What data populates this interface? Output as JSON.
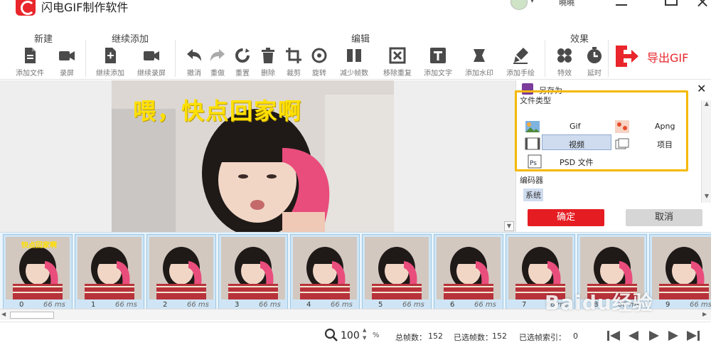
{
  "app": {
    "title": "闪电GIF制作软件",
    "user_name": "曉曉",
    "dropdown_glyph": "▾"
  },
  "toolbar": {
    "groups": [
      {
        "label": "新建"
      },
      {
        "label": "继续添加"
      },
      {
        "label": "编辑"
      },
      {
        "label": "效果"
      }
    ],
    "tools": [
      {
        "label": "添加文件",
        "icon": "document-icon"
      },
      {
        "label": "录屏",
        "icon": "video-camera-icon"
      },
      {
        "label": "继续添加",
        "icon": "document-add-icon"
      },
      {
        "label": "继续录屏",
        "icon": "video-camera-add-icon"
      },
      {
        "label": "撤消",
        "icon": "undo-icon"
      },
      {
        "label": "重做",
        "icon": "redo-icon"
      },
      {
        "label": "重置",
        "icon": "reset-icon"
      },
      {
        "label": "删除",
        "icon": "trash-icon"
      },
      {
        "label": "裁剪",
        "icon": "crop-icon"
      },
      {
        "label": "旋转",
        "icon": "rotate-icon"
      },
      {
        "label": "减少帧数",
        "icon": "reduce-frames-icon"
      },
      {
        "label": "移除重复",
        "icon": "remove-duplicate-icon"
      },
      {
        "label": "添加文字",
        "icon": "text-icon"
      },
      {
        "label": "添加水印",
        "icon": "watermark-icon"
      },
      {
        "label": "添加手绘",
        "icon": "brush-icon"
      },
      {
        "label": "特效",
        "icon": "effects-icon"
      },
      {
        "label": "延时",
        "icon": "timer-icon"
      }
    ],
    "export_label": "导出GIF"
  },
  "preview": {
    "caption": "喂，快点回家啊"
  },
  "save_panel": {
    "title": "另存为",
    "file_type_label": "文件类型",
    "options": [
      {
        "label": "Gif",
        "icon": "gif-image-icon"
      },
      {
        "label": "Apng",
        "icon": "apng-image-icon"
      },
      {
        "label": "视频",
        "icon": "video-film-icon",
        "selected": true
      },
      {
        "label": "项目",
        "icon": "project-icon"
      },
      {
        "label": "PSD 文件",
        "icon": "photoshop-icon"
      }
    ],
    "encoder_label": "编码器",
    "encoder_value": "系统",
    "confirm_label": "确定",
    "cancel_label": "取消"
  },
  "filmstrip": {
    "first_frame_caption": "快点回家啊",
    "frames": [
      {
        "index": "0",
        "duration": "66 ms"
      },
      {
        "index": "1",
        "duration": "66 ms"
      },
      {
        "index": "2",
        "duration": "66 ms"
      },
      {
        "index": "3",
        "duration": "66 ms"
      },
      {
        "index": "4",
        "duration": "66 ms"
      },
      {
        "index": "5",
        "duration": "66 ms"
      },
      {
        "index": "6",
        "duration": "66 ms"
      },
      {
        "index": "7",
        "duration": "66 ms"
      },
      {
        "index": "8",
        "duration": "66 ms"
      },
      {
        "index": "9",
        "duration": "66 ms"
      }
    ]
  },
  "status": {
    "zoom": "100",
    "zoom_unit": "%",
    "total_frames_label": "总帧数：",
    "total_frames": "152",
    "selected_frames_label": "已选帧数：",
    "selected_frames": "152",
    "selected_index_label": "已选帧索引：",
    "selected_index": "0"
  },
  "watermark": "Baidu经验",
  "colors": {
    "brand_red": "#e8262b",
    "highlight": "#f5b800",
    "selection": "#cfdcef"
  }
}
